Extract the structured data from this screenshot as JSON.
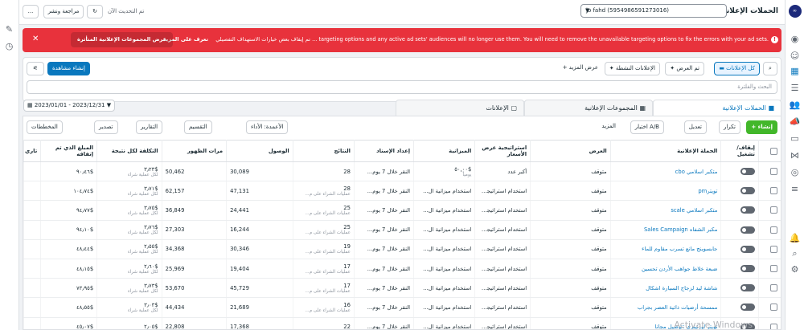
{
  "header": {
    "title": "الحملات الإعلانية",
    "account": "jo fahd (5954986591273016)",
    "updated": "تم التحديث الآن",
    "review_publish": "مراجعة ونشر",
    "more": "...",
    "refresh": "↻"
  },
  "banner": {
    "message": "تم إيقاف بعض خيارات الاستهداف التفصيلي ... targeting options and any active ad sets' audiences will no longer use them. You will need to remove the unavailable targeting options to fix the errors with your ad sets.",
    "learn_more": "تعرف على المزيد",
    "view_affected": "عرض المجموعات الإعلانية المتأثرة",
    "close": "✕",
    "warn": "!"
  },
  "filters": {
    "search_icon": "⌕",
    "all_ads": "كل الإعلانات",
    "shown": "تم العرض",
    "active_ads": "الإعلانات النشطة",
    "show_more": "+ عرض المزيد",
    "create_view": "إنشاء مشاهدة",
    "search_placeholder": "البحث والفلترة"
  },
  "tabs": {
    "campaigns": "الحملات الإعلانية",
    "adsets": "المجموعات الإعلانية",
    "ads": "الإعلانات"
  },
  "daterange": "2023/01/01 - 2023/12/31 ▼",
  "toolbar": {
    "create": "+ إنشاء",
    "duplicate": "تكرار",
    "edit": "تعديل",
    "ab_test": "اختبار A/B",
    "more": "المزيد",
    "columns": "الأعمدة: الأداء",
    "breakdown": "التقسيم",
    "reports": "التقارير",
    "export": "تصدير",
    "charts": "المخططات"
  },
  "columns": {
    "toggle": "إيقاف/ تشغيل",
    "name": "الحملة الإعلانية",
    "delivery": "العرض",
    "bid_strategy": "استراتيجية عرض الأسعار",
    "budget": "الميزانية",
    "attribution": "إعداد الإسناد",
    "results": "النتائج",
    "reach": "الوصول",
    "impressions": "مرات الظهور",
    "cost_per_result": "التكلفة لكل نتيجة",
    "amount_spent": "المبلغ الذي تم إنفاقه",
    "end": "تاري"
  },
  "rows": [
    {
      "name": "متكبر اسلامي cbo",
      "delivery": "متوقف",
      "bid": "أكبر عدد",
      "budget": "$٥٠,٠٠",
      "budget_sub": "يومياً",
      "attribution": "النقر خلال 7 يوم...",
      "results": "28",
      "results_sub": "",
      "reach": "30,089",
      "impressions": "50,462",
      "cost": "$٣٫٢٣",
      "cost_sub": "لكل عملية شراء",
      "spent": "$٩٠٫٤٦"
    },
    {
      "name": "تويترpm",
      "delivery": "متوقف",
      "bid": "استخدام استراتيجي...",
      "budget": "استخدام ميزانية ال...",
      "budget_sub": "",
      "attribution": "النقر خلال 7 يوم...",
      "results": "28",
      "results_sub": "عمليات الشراء على م...",
      "reach": "47,131",
      "impressions": "62,157",
      "cost": "$٣٫٧١",
      "cost_sub": "لكل عملية شراء",
      "spent": "$١٠٤٫٧٤"
    },
    {
      "name": "متكبر اسلامي scale",
      "delivery": "متوقف",
      "bid": "استخدام استراتيجي...",
      "budget": "استخدام ميزانية ال...",
      "budget_sub": "",
      "attribution": "النقر خلال 7 يوم...",
      "results": "25",
      "results_sub": "عمليات الشراء على م...",
      "reach": "24,441",
      "impressions": "36,849",
      "cost": "$٣٫٧٥",
      "cost_sub": "لكل عملية شراء",
      "spent": "$٩٤٫٧٧"
    },
    {
      "name": "مكبر الشفاه Sales Campaign",
      "delivery": "متوقف",
      "bid": "استخدام استراتيجي...",
      "budget": "استخدام ميزانية ال...",
      "budget_sub": "",
      "attribution": "النقر خلال 7 يوم...",
      "results": "25",
      "results_sub": "عمليات الشراء على م...",
      "reach": "16,244",
      "impressions": "27,303",
      "cost": "$٣٫٧٦",
      "cost_sub": "لكل عملية شراء",
      "spent": "$٩٤٫١٠"
    },
    {
      "name": "جابسوبنج مانع تسرب مقاوم للماء",
      "delivery": "متوقف",
      "bid": "استخدام استراتيجي...",
      "budget": "استخدام ميزانية ال...",
      "budget_sub": "",
      "attribution": "النقر خلال 7 يوم...",
      "results": "19",
      "results_sub": "عمليات الشراء على م...",
      "reach": "30,346",
      "impressions": "34,368",
      "cost": "$٢٫٥٥",
      "cost_sub": "لكل عملية شراء",
      "spent": "$٤٨٫٤٤"
    },
    {
      "name": "ضبعة خلاط جواهب الأردن تحسين",
      "delivery": "متوقف",
      "bid": "استخدام استراتيجي...",
      "budget": "استخدام ميزانية ال...",
      "budget_sub": "",
      "attribution": "النقر خلال 7 يوم...",
      "results": "17",
      "results_sub": "عمليات الشراء على م...",
      "reach": "19,404",
      "impressions": "25,969",
      "cost": "$٢٫٦٠",
      "cost_sub": "لكل عملية شراء",
      "spent": "$٤٨٫١٥"
    },
    {
      "name": "شاشة ليد لزجاج السيارة اشكال",
      "delivery": "متوقف",
      "bid": "استخدام استراتيجي...",
      "budget": "استخدام ميزانية ال...",
      "budget_sub": "",
      "attribution": "النقر خلال 7 يوم...",
      "results": "17",
      "results_sub": "عمليات الشراء على م...",
      "reach": "45,729",
      "impressions": "53,670",
      "cost": "$٣٫٧٣",
      "cost_sub": "لكل عملية شراء",
      "spent": "$٧٣٫٩٥"
    },
    {
      "name": "ممسحة أرضيات ذاتية العصر بجراب",
      "delivery": "متوقف",
      "bid": "استخدام استراتيجي...",
      "budget": "استخدام ميزانية ال...",
      "budget_sub": "",
      "attribution": "النقر خلال 7 يوم...",
      "results": "16",
      "results_sub": "عمليات الشراء على م...",
      "reach": "21,689",
      "impressions": "44,434",
      "cost": "$٣٫٠٣",
      "cost_sub": "لكل عملية شراء",
      "spent": "$٤٨٫٥٥"
    },
    {
      "name": "تويتر اورنيتري :توصيل مجانا",
      "delivery": "متوقف",
      "bid": "استخدام استراتيجي...",
      "budget": "استخدام ميزانية ال...",
      "budget_sub": "",
      "attribution": "النقر خلال 7 يوم...",
      "results": "22",
      "results_sub": "",
      "reach": "17,368",
      "impressions": "22,808",
      "cost": "$٢٫٠٥",
      "cost_sub": "",
      "spent": "$٤٥٫٠٧"
    }
  ],
  "watermark": "Activate Windows",
  "rail_right": [
    "meta-icon",
    "ads-manager-icon",
    "account-overview-icon",
    "campaigns-icon",
    "audiences-icon",
    "people-icon",
    "advertise-icon",
    "billing-icon",
    "events-icon",
    "tools-icon",
    "reports-icon",
    "menu-icon"
  ],
  "rail_left": [
    "pencil-icon",
    "clock-icon"
  ]
}
